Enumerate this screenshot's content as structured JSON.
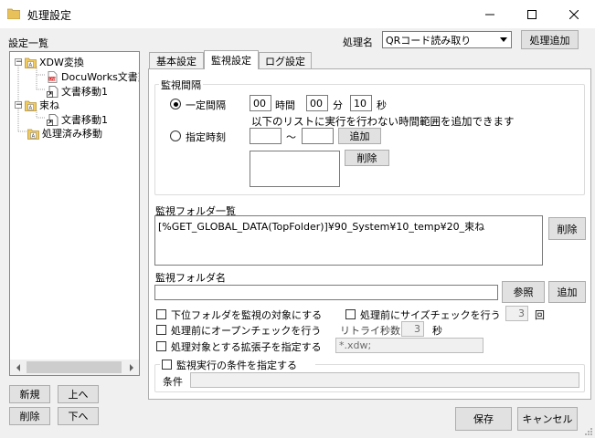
{
  "window": {
    "title": "処理設定",
    "controls": {
      "minimize": "—",
      "maximize": "☐",
      "close": "✕"
    }
  },
  "left": {
    "label": "設定一覧",
    "tree": [
      {
        "label": "XDW変換",
        "expander": "−",
        "icon": "folder-icon"
      },
      {
        "label": "DocuWorks文書変換",
        "icon": "docuworks-icon"
      },
      {
        "label": "文書移動1",
        "icon": "document-move-icon"
      },
      {
        "label": "束ね",
        "expander": "−",
        "icon": "folder-icon"
      },
      {
        "label": "文書移動1",
        "icon": "document-move-icon"
      },
      {
        "label": "処理済み移動",
        "icon": "folder-icon"
      }
    ],
    "buttons": {
      "new": "新規",
      "up": "上へ",
      "delete": "削除",
      "down": "下へ"
    }
  },
  "header": {
    "process_name_label": "処理名",
    "process_name_value": "QRコード読み取り",
    "add_process_button": "処理追加"
  },
  "tabs": [
    "基本設定",
    "監視設定",
    "ログ設定"
  ],
  "active_tab": "監視設定",
  "interval": {
    "group_title": "監視間隔",
    "fixed_label": "一定間隔",
    "fixed_selected": true,
    "hours": "00",
    "hours_unit": "時間",
    "minutes": "00",
    "minutes_unit": "分",
    "seconds": "10",
    "seconds_unit": "秒",
    "note": "以下のリストに実行を行わない時間範囲を追加できます",
    "specified_label": "指定時刻",
    "tilde": "〜",
    "add_button": "追加",
    "delete_button": "削除"
  },
  "folders": {
    "list_label": "監視フォルダ一覧",
    "list_items": [
      "[%GET_GLOBAL_DATA(TopFolder)]¥90_System¥10_temp¥20_束ね"
    ],
    "delete_button": "削除",
    "name_label": "監視フォルダ名",
    "name_value": "",
    "browse_button": "参照",
    "add_button": "追加"
  },
  "options": {
    "subfolders": "下位フォルダを監視の対象にする",
    "size_check": "処理前にサイズチェックを行う",
    "size_check_count": "3",
    "size_check_unit": "回",
    "open_check": "処理前にオープンチェックを行う",
    "retry_label": "リトライ秒数",
    "retry_value": "3",
    "retry_unit": "秒",
    "extension": "処理対象とする拡張子を指定する",
    "extension_value": "*.xdw;",
    "condition_group": "監視実行の条件を指定する",
    "condition_label": "条件",
    "condition_value": ""
  },
  "footer": {
    "save": "保存",
    "cancel": "キャンセル"
  }
}
